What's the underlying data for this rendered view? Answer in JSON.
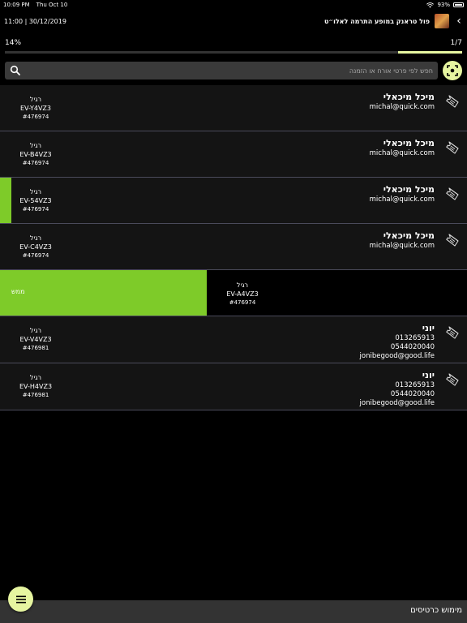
{
  "status": {
    "time": "10:09 PM",
    "day": "Thu Oct 10",
    "battery": "93%"
  },
  "header": {
    "date_time": "11:00 | 30/12/2019",
    "event_title": "פול טראנק במופע התרמה לאלו״ט"
  },
  "progress": {
    "percent_label": "14%",
    "count_label": "1/7",
    "fraction": 0.14
  },
  "search": {
    "placeholder": "חפש לפי פרטי אורח או הזמנה"
  },
  "tickets": [
    {
      "name": "מיכל מיכאלי",
      "lines": [
        "michal@quick.com"
      ],
      "type": "רגיל",
      "code": "EV-Y4VZ3",
      "order": "#476974"
    },
    {
      "name": "מיכל מיכאלי",
      "lines": [
        "michal@quick.com"
      ],
      "type": "רגיל",
      "code": "EV-B4VZ3",
      "order": "#476974"
    },
    {
      "name": "מיכל מיכאלי",
      "lines": [
        "michal@quick.com"
      ],
      "type": "רגיל",
      "code": "EV-54VZ3",
      "order": "#476974"
    },
    {
      "name": "מיכל מיכאלי",
      "lines": [
        "michal@quick.com"
      ],
      "type": "רגיל",
      "code": "EV-C4VZ3",
      "order": "#476974"
    },
    {
      "type": "רגיל",
      "code": "EV-A4VZ3",
      "order": "#476974",
      "action_label": "ממש"
    },
    {
      "name": "יוני",
      "lines": [
        "013265913",
        "0544020040",
        "jonibegood@good.life"
      ],
      "type": "רגיל",
      "code": "EV-V4VZ3",
      "order": "#476981"
    },
    {
      "name": "יוני",
      "lines": [
        "013265913",
        "0544020040",
        "jonibegood@good.life"
      ],
      "type": "רגיל",
      "code": "EV-H4VZ3",
      "order": "#476981"
    }
  ],
  "footer": {
    "label": "מימוש כרטיסים"
  },
  "colors": {
    "accent": "#7ecb29",
    "highlight": "#e6f5a0"
  }
}
